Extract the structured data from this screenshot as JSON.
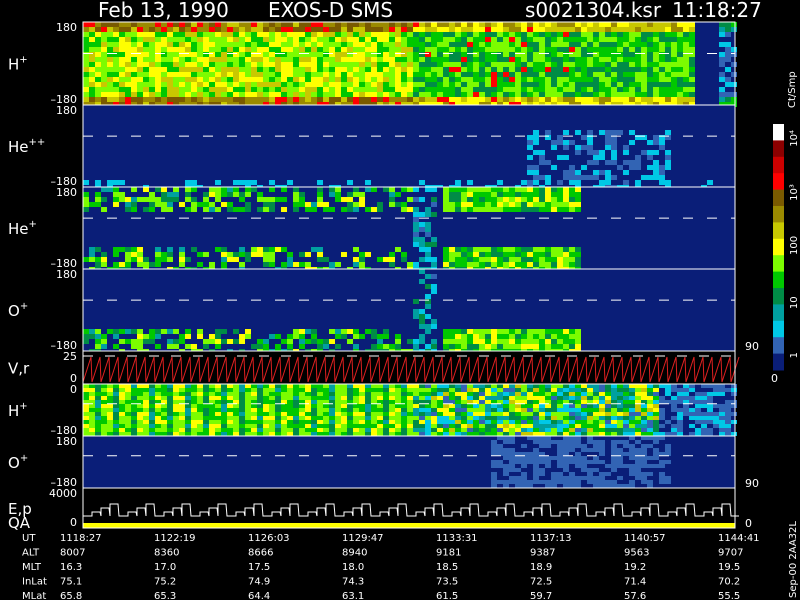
{
  "header": {
    "date": "Feb 13, 1990",
    "instrument": "EXOS-D SMS",
    "file": "s0021304.ksr",
    "time": "11:18:27"
  },
  "colorbar": {
    "unit": "Ct/Smp",
    "labels": [
      "10⁴",
      "10³",
      "100",
      "10",
      "1",
      "0"
    ],
    "colors": [
      "#ffffff",
      "#8b0000",
      "#cc0000",
      "#ff0000",
      "#7a5a00",
      "#9b8a00",
      "#c8c800",
      "#ffff00",
      "#7cfc00",
      "#00c800",
      "#008c46",
      "#00a0a0",
      "#00c8e6",
      "#3264b4",
      "#0a1e78"
    ]
  },
  "panels": [
    {
      "id": "h-plus-angle",
      "label": "H",
      "sup": "+",
      "ticks": [
        "180",
        "–180"
      ]
    },
    {
      "id": "he-plusplus-angle",
      "label": "He",
      "sup": "++",
      "ticks": [
        "180",
        "–180"
      ]
    },
    {
      "id": "he-plus-angle",
      "label": "He",
      "sup": "+",
      "ticks": [
        "180",
        "–180"
      ]
    },
    {
      "id": "o-plus-angle",
      "label": "O",
      "sup": "+",
      "ticks": [
        "180",
        "–180"
      ],
      "right_tick": "90"
    },
    {
      "id": "vr",
      "label": "V,r",
      "ticks": [
        "25",
        "0"
      ]
    },
    {
      "id": "h-plus-lower",
      "label": "H",
      "sup": "+",
      "ticks": [
        "0",
        "–180"
      ]
    },
    {
      "id": "o-plus-lower",
      "label": "O",
      "sup": "+",
      "ticks": [
        "180",
        "–180"
      ],
      "right_tick": "90"
    },
    {
      "id": "ep-qa",
      "label": "E,p",
      "label2": "QA",
      "ticks": [
        "4000",
        "0"
      ],
      "right_tick": "0"
    }
  ],
  "axis_table": {
    "rows": [
      {
        "name": "UT",
        "values": [
          "1118:27",
          "1122:19",
          "1126:03",
          "1129:47",
          "1133:31",
          "1137:13",
          "1140:57",
          "1144:41"
        ]
      },
      {
        "name": "ALT",
        "values": [
          "8007",
          "8360",
          "8666",
          "8940",
          "9181",
          "9387",
          "9563",
          "9707"
        ]
      },
      {
        "name": "MLT",
        "values": [
          "16.3",
          "17.0",
          "17.5",
          "18.0",
          "18.5",
          "18.9",
          "19.2",
          "19.5"
        ]
      },
      {
        "name": "InLat",
        "values": [
          "75.1",
          "75.2",
          "74.9",
          "74.3",
          "73.5",
          "72.5",
          "71.4",
          "70.2"
        ]
      },
      {
        "name": "MLat",
        "values": [
          "65.8",
          "65.3",
          "64.4",
          "63.1",
          "61.5",
          "59.7",
          "57.6",
          "55.5"
        ]
      }
    ]
  },
  "side_label": "Sep-00 2AA32L",
  "chart_data": {
    "type": "heatmap",
    "title": "Feb 13, 1990   EXOS-D SMS   s0021304.ksr  11:18:27",
    "x": [
      "1118:27",
      "1122:19",
      "1126:03",
      "1129:47",
      "1133:31",
      "1137:13",
      "1140:57",
      "1144:41"
    ],
    "panels": [
      "H+",
      "He++",
      "He+",
      "O+",
      "V,r",
      "H+",
      "O+",
      "E,p QA"
    ],
    "colorbar_unit": "Ct/Smp",
    "colorbar_ticks": [
      "1",
      "10",
      "100",
      "10³",
      "10⁴"
    ]
  }
}
